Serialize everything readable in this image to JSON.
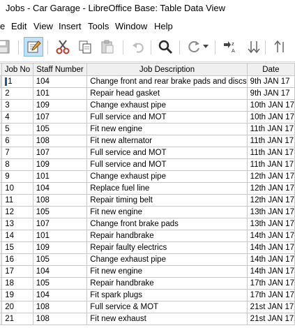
{
  "window": {
    "title": "Jobs - Car Garage - LibreOffice Base: Table Data View"
  },
  "menu": [
    "e",
    "Edit",
    "View",
    "Insert",
    "Tools",
    "Window",
    "Help"
  ],
  "toolbar": {
    "icons": [
      "save-icon",
      "edit-icon",
      "cut-icon",
      "copy-icon",
      "paste-icon",
      "undo-icon",
      "find-icon",
      "refresh-icon",
      "dropdown-icon",
      "sort-icon",
      "sort-ascending-icon",
      "sort-descending-icon"
    ]
  },
  "table": {
    "columns": [
      "Job No",
      "Staff Number",
      "Job Description",
      "Date"
    ],
    "rows": [
      [
        "1",
        "104",
        "Change front and rear brake pads and discs",
        "9th JAN 17"
      ],
      [
        "2",
        "101",
        "Repair head gasket",
        "9th JAN 17"
      ],
      [
        "3",
        "109",
        "Change exhaust pipe",
        "10th JAN 17"
      ],
      [
        "4",
        "107",
        "Full service and MOT",
        "10th JAN 17"
      ],
      [
        "5",
        "105",
        "Fit new engine",
        "11th JAN 17"
      ],
      [
        "6",
        "108",
        "Fit new alternator",
        "11th JAN 17"
      ],
      [
        "7",
        "107",
        "Full service and MOT",
        "11th JAN 17"
      ],
      [
        "8",
        "109",
        "Full service and MOT",
        "11th JAN 17"
      ],
      [
        "9",
        "101",
        "Change exhaust pipe",
        "12th JAN 17"
      ],
      [
        "10",
        "104",
        "Replace fuel line",
        "12th JAN 17"
      ],
      [
        "11",
        "108",
        "Repair timing belt",
        "12th JAN 17"
      ],
      [
        "12",
        "105",
        "Fit new engine",
        "13th JAN 17"
      ],
      [
        "13",
        "107",
        "Change front brake pads",
        "13th JAN 17"
      ],
      [
        "14",
        "101",
        "Repair handbrake",
        "14th JAN 17"
      ],
      [
        "15",
        "109",
        "Repair faulty electrics",
        "14th JAN 17"
      ],
      [
        "16",
        "105",
        "Change exhaust pipe",
        "14th JAN 17"
      ],
      [
        "17",
        "104",
        "Fit new engine",
        "14th JAN 17"
      ],
      [
        "18",
        "105",
        "Repair handbrake",
        "17th JAN 17"
      ],
      [
        "19",
        "104",
        "Fit spark plugs",
        "17th JAN 17"
      ],
      [
        "20",
        "108",
        "Full service & MOT",
        "21st JAN 17"
      ],
      [
        "21",
        "108",
        "Fit new exhaust",
        "21st JAN 17"
      ]
    ]
  }
}
